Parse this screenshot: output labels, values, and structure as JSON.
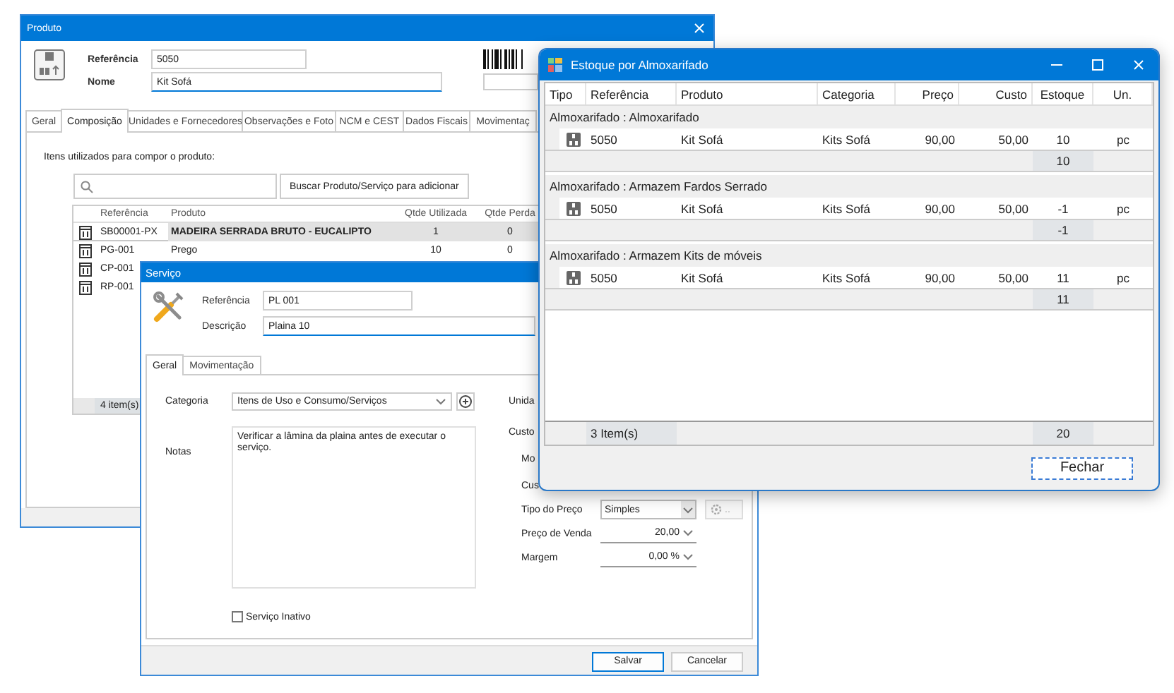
{
  "produto_window": {
    "title": "Produto",
    "fields": [
      {
        "label": "Referência",
        "value": "5050"
      },
      {
        "label": "Nome",
        "value": "Kit Sofá"
      }
    ],
    "tabs": [
      {
        "label": "Geral",
        "selected": false
      },
      {
        "label": "Composição",
        "selected": true
      },
      {
        "label": "Unidades e Fornecedores",
        "selected": false
      },
      {
        "label": "Observações e Foto",
        "selected": false
      },
      {
        "label": "NCM e CEST",
        "selected": false
      },
      {
        "label": "Dados Fiscais",
        "selected": false
      },
      {
        "label": "Movimentaç",
        "selected": false
      }
    ],
    "section_label": "Itens utilizados para compor o produto:",
    "search_button": "Buscar Produto/Serviço para adicionar",
    "table": {
      "columns": [
        "Referência",
        "Produto",
        "Qtde Utilizada",
        "Qtde Perda"
      ],
      "rows": [
        {
          "cells": [
            "SB00001-PX",
            "MADEIRA SERRADA BRUTO - EUCALIPTO",
            "1",
            "0"
          ],
          "selected": true
        },
        {
          "cells": [
            "PG-001",
            "Prego",
            "10",
            "0"
          ],
          "selected": false
        },
        {
          "cells": [
            "CP-001"
          ],
          "selected": false
        },
        {
          "cells": [
            "RP-001"
          ],
          "selected": false
        }
      ],
      "footer": "4 item(s)"
    }
  },
  "servico_window": {
    "title": "Serviço",
    "fields": [
      {
        "label": "Referência",
        "value": "PL 001"
      },
      {
        "label": "Descrição",
        "value": "Plaina 10"
      }
    ],
    "tabs": [
      {
        "label": "Geral",
        "selected": true
      },
      {
        "label": "Movimentação",
        "selected": false
      }
    ],
    "categoria": {
      "label": "Categoria",
      "value": "Itens de Uso e Consumo/Serviços"
    },
    "notas": {
      "label": "Notas",
      "value": "Verificar a lâmina da plaina antes de executar o serviço."
    },
    "side_labels": [
      {
        "text": "Unida",
        "kind": "head"
      },
      {
        "text": "Custo",
        "kind": "head"
      },
      {
        "text": "Mo",
        "kind": "sub"
      },
      {
        "text": "Cus",
        "kind": "sub"
      }
    ],
    "price_rows": [
      {
        "label": "Tipo do Preço",
        "value": "Simples",
        "kind": "select"
      },
      {
        "label": "Preço de Venda",
        "value": "20,00",
        "kind": "number"
      },
      {
        "label": "Margem",
        "value": "0,00 %",
        "kind": "number"
      }
    ],
    "options_button": "..",
    "inativo": {
      "label": "Serviço Inativo",
      "checked": false
    },
    "buttons": [
      "Salvar",
      "Cancelar"
    ]
  },
  "estoque_window": {
    "title": "Estoque por Almoxarifado",
    "columns": [
      "Tipo",
      "Referência",
      "Produto",
      "Categoria",
      "Preço",
      "Custo",
      "Estoque",
      "Un."
    ],
    "groups": [
      {
        "title": "Almoxarifado : Almoxarifado",
        "rows": [
          {
            "cells": [
              "5050",
              "Kit Sofá",
              "Kits Sofá",
              "90,00",
              "50,00",
              "10",
              "pc"
            ]
          }
        ],
        "subtotal": "10"
      },
      {
        "title": "Almoxarifado : Armazem Fardos Serrado",
        "rows": [
          {
            "cells": [
              "5050",
              "Kit Sofá",
              "Kits Sofá",
              "90,00",
              "50,00",
              "-1",
              "pc"
            ]
          }
        ],
        "subtotal": "-1"
      },
      {
        "title": "Almoxarifado : Armazem Kits de móveis",
        "rows": [
          {
            "cells": [
              "5050",
              "Kit Sofá",
              "Kits Sofá",
              "90,00",
              "50,00",
              "11",
              "pc"
            ]
          }
        ],
        "subtotal": "11"
      }
    ],
    "footer": {
      "count": "3 Item(s)",
      "total": "20"
    },
    "close_button": "Fechar"
  }
}
